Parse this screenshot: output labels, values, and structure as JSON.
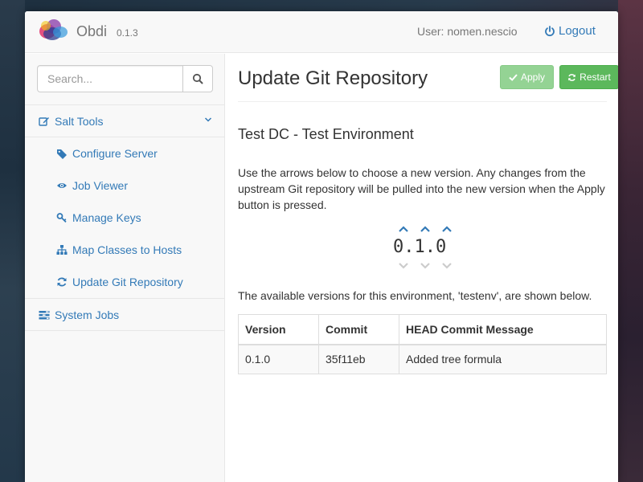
{
  "app": {
    "brand": "Obdi",
    "version": "0.1.3",
    "user_label": "User: nomen.nescio",
    "logout_label": "Logout"
  },
  "sidebar": {
    "search_placeholder": "Search...",
    "sections": [
      {
        "label": "Salt Tools",
        "icon": "edit-icon",
        "expanded": true,
        "items": [
          {
            "label": "Configure Server",
            "icon": "tags-icon"
          },
          {
            "label": "Job Viewer",
            "icon": "eye-icon"
          },
          {
            "label": "Manage Keys",
            "icon": "key-icon"
          },
          {
            "label": "Map Classes to Hosts",
            "icon": "sitemap-icon"
          },
          {
            "label": "Update Git Repository",
            "icon": "refresh-icon"
          }
        ]
      },
      {
        "label": "System Jobs",
        "icon": "tasks-icon"
      }
    ]
  },
  "main": {
    "title": "Update Git Repository",
    "apply_label": "Apply",
    "restart_label": "Restart",
    "environment": "Test DC - Test Environment",
    "description": "Use the arrows below to choose a new version. Any changes from the upstream Git repository will be pulled into the new version when the Apply button is pressed.",
    "version_picker": {
      "value": "0.1.0"
    },
    "available_text": "The available versions for this environment, 'testenv', are shown below.",
    "table": {
      "headers": [
        "Version",
        "Commit",
        "HEAD Commit Message"
      ],
      "rows": [
        [
          "0.1.0",
          "35f11eb",
          "Added tree formula"
        ]
      ]
    }
  },
  "colors": {
    "link": "#337ab7",
    "success": "#5cb85c",
    "success_disabled": "#8fd18f"
  }
}
